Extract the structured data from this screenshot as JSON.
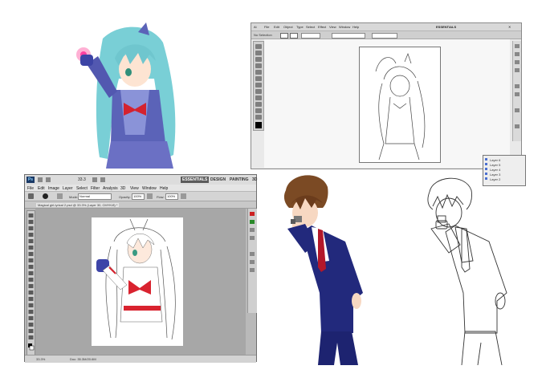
{
  "illustrator": {
    "menus": [
      "Ai",
      "File",
      "Edit",
      "Object",
      "Type",
      "Select",
      "Effect",
      "View",
      "Window",
      "Help"
    ],
    "workspace": "ESSENTIALS",
    "control_label": "No Selection",
    "layers_panel": {
      "rows": [
        "Layer 6",
        "Layer 5",
        "Layer 4",
        "Layer 3",
        "Layer 2"
      ]
    }
  },
  "photoshop": {
    "logo": "Ps",
    "workspaces": [
      "ESSENTIALS",
      "DESIGN",
      "PAINTING",
      "3D"
    ],
    "active_workspace": "ESSENTIALS",
    "menus": [
      "File",
      "Edit",
      "Image",
      "Layer",
      "Select",
      "Filter",
      "Analysis",
      "3D",
      "View",
      "Window",
      "Help"
    ],
    "options": {
      "mode_label": "Mode:",
      "mode_value": "Normal",
      "opacity_label": "Opacity:",
      "opacity_value": "100%",
      "flow_label": "Flow:",
      "flow_value": "100%"
    },
    "zoom_top": "33.3",
    "doc_tab": "Magical girl-lyrical 2.psd @ 33.3% (Layer 30, CMYK/8) *",
    "status_zoom": "33.3%",
    "status_doc": "Doc: 35.3M/20.6M"
  },
  "colors": {
    "ps_active_workspace": "#5b5b5b",
    "ai_teal_hair": "#7fd3d8",
    "suit_navy": "#21287a",
    "tie_red": "#b3182a"
  }
}
